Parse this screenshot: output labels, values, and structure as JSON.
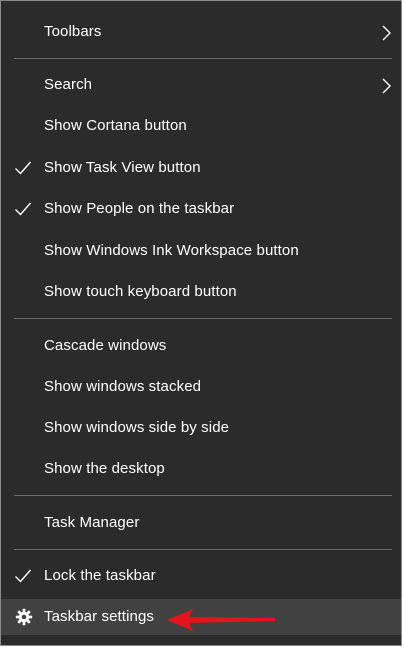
{
  "menu": {
    "toolbars": {
      "label": "Toolbars"
    },
    "search": {
      "label": "Search"
    },
    "show_cortana": {
      "label": "Show Cortana button"
    },
    "show_task_view": {
      "label": "Show Task View button",
      "checked": true
    },
    "show_people": {
      "label": "Show People on the taskbar",
      "checked": true
    },
    "show_ink": {
      "label": "Show Windows Ink Workspace button"
    },
    "show_touch_keyboard": {
      "label": "Show touch keyboard button"
    },
    "cascade": {
      "label": "Cascade windows"
    },
    "stacked": {
      "label": "Show windows stacked"
    },
    "side_by_side": {
      "label": "Show windows side by side"
    },
    "show_desktop": {
      "label": "Show the desktop"
    },
    "task_manager": {
      "label": "Task Manager"
    },
    "lock_taskbar": {
      "label": "Lock the taskbar",
      "checked": true
    },
    "taskbar_settings": {
      "label": "Taskbar settings",
      "icon": "gear-icon",
      "hovered": true
    }
  },
  "colors": {
    "menu_bg": "#2b2b2b",
    "hover_bg": "#414141",
    "text": "#ffffff",
    "separator": "#6b6b6b",
    "annotation_arrow": "#e3141b"
  }
}
